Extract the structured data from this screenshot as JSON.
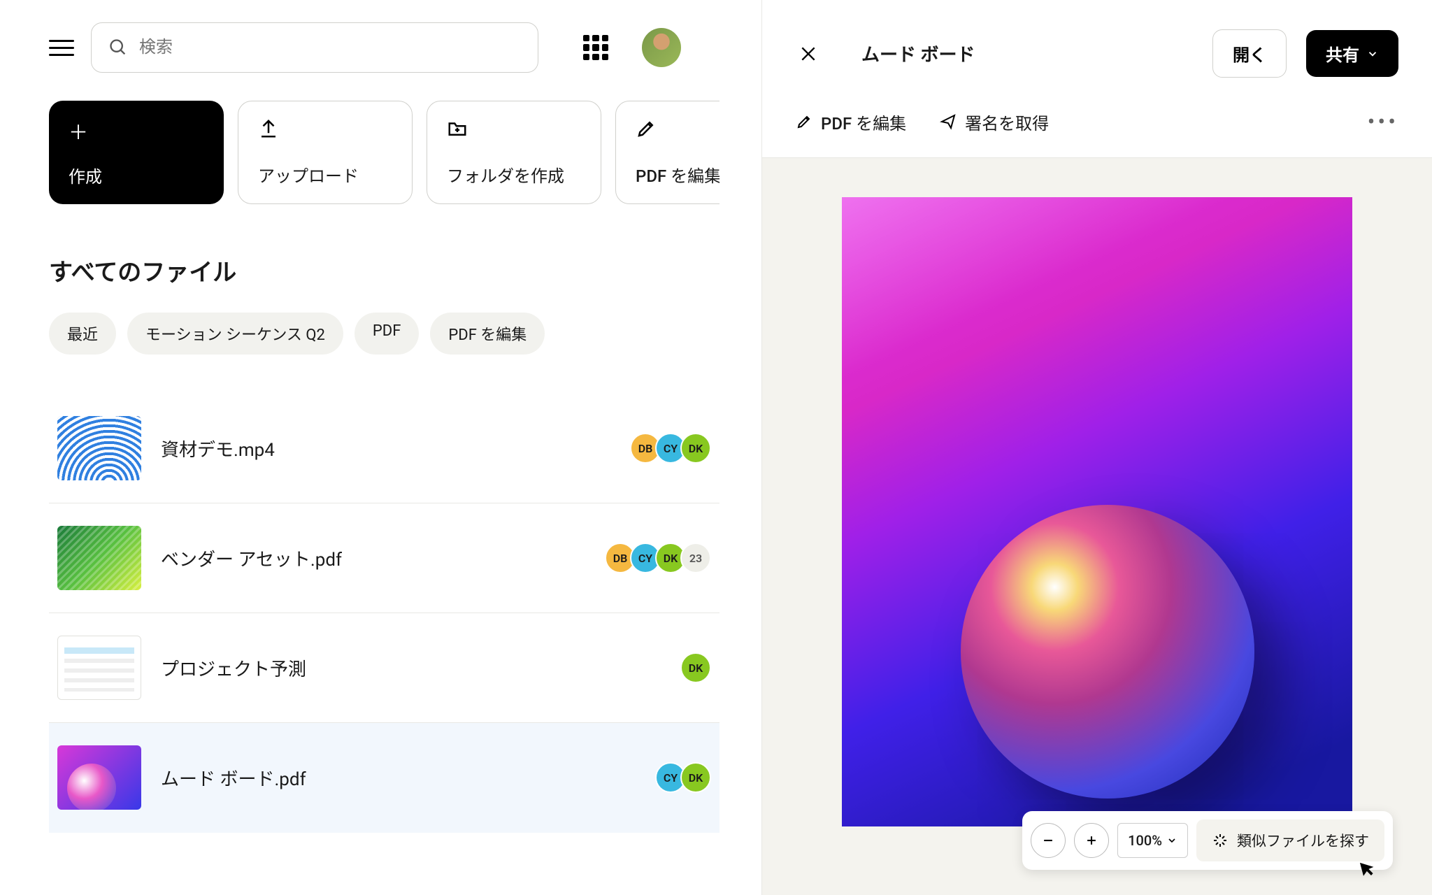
{
  "header": {
    "search_placeholder": "検索"
  },
  "actions": [
    {
      "label": "作成"
    },
    {
      "label": "アップロード"
    },
    {
      "label": "フォルダを作成"
    },
    {
      "label": "PDF を編集"
    }
  ],
  "section_title": "すべてのファイル",
  "chips": [
    {
      "label": "最近"
    },
    {
      "label": "モーション シーケンス Q2"
    },
    {
      "label": "PDF"
    },
    {
      "label": "PDF を編集"
    }
  ],
  "files": [
    {
      "name": "資材デモ.mp4"
    },
    {
      "name": "ベンダー アセット.pdf"
    },
    {
      "name": "プロジェクト予測"
    },
    {
      "name": "ムード ボード.pdf"
    }
  ],
  "badges": {
    "db": "DB",
    "cy": "CY",
    "dk": "DK",
    "more": "23"
  },
  "colors": {
    "db": "#f5b840",
    "cy": "#38b8e0",
    "dk": "#88c820"
  },
  "right": {
    "title": "ムード ボード",
    "open": "開く",
    "share": "共有",
    "edit_pdf": "PDF を編集",
    "get_signature": "署名を取得",
    "zoom": "100%",
    "find_similar": "類似ファイルを探す"
  }
}
